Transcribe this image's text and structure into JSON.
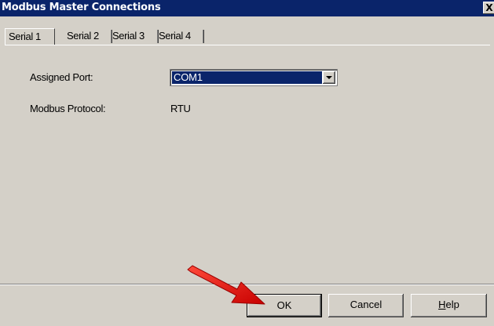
{
  "window": {
    "title": "Modbus Master Connections",
    "close_label": "X"
  },
  "tabs": [
    {
      "label": "Serial 1",
      "active": true
    },
    {
      "label": "Serial 2",
      "active": false
    },
    {
      "label": "Serial 3",
      "active": false
    },
    {
      "label": "Serial 4",
      "active": false
    }
  ],
  "fields": {
    "assigned_port_label": "Assigned Port:",
    "assigned_port_value": "COM1",
    "protocol_label": "Modbus Protocol:",
    "protocol_value": "RTU"
  },
  "buttons": {
    "ok": "OK",
    "cancel": "Cancel",
    "help_underlined": "H",
    "help_rest": "elp"
  },
  "colors": {
    "titlebar": "#0a246a",
    "dialog_face": "#d4d0c8",
    "annotation_arrow": "#e00000"
  },
  "icons": {
    "close": "close-icon",
    "dropdown": "chevron-down-icon",
    "annotation": "red-arrow-icon"
  }
}
